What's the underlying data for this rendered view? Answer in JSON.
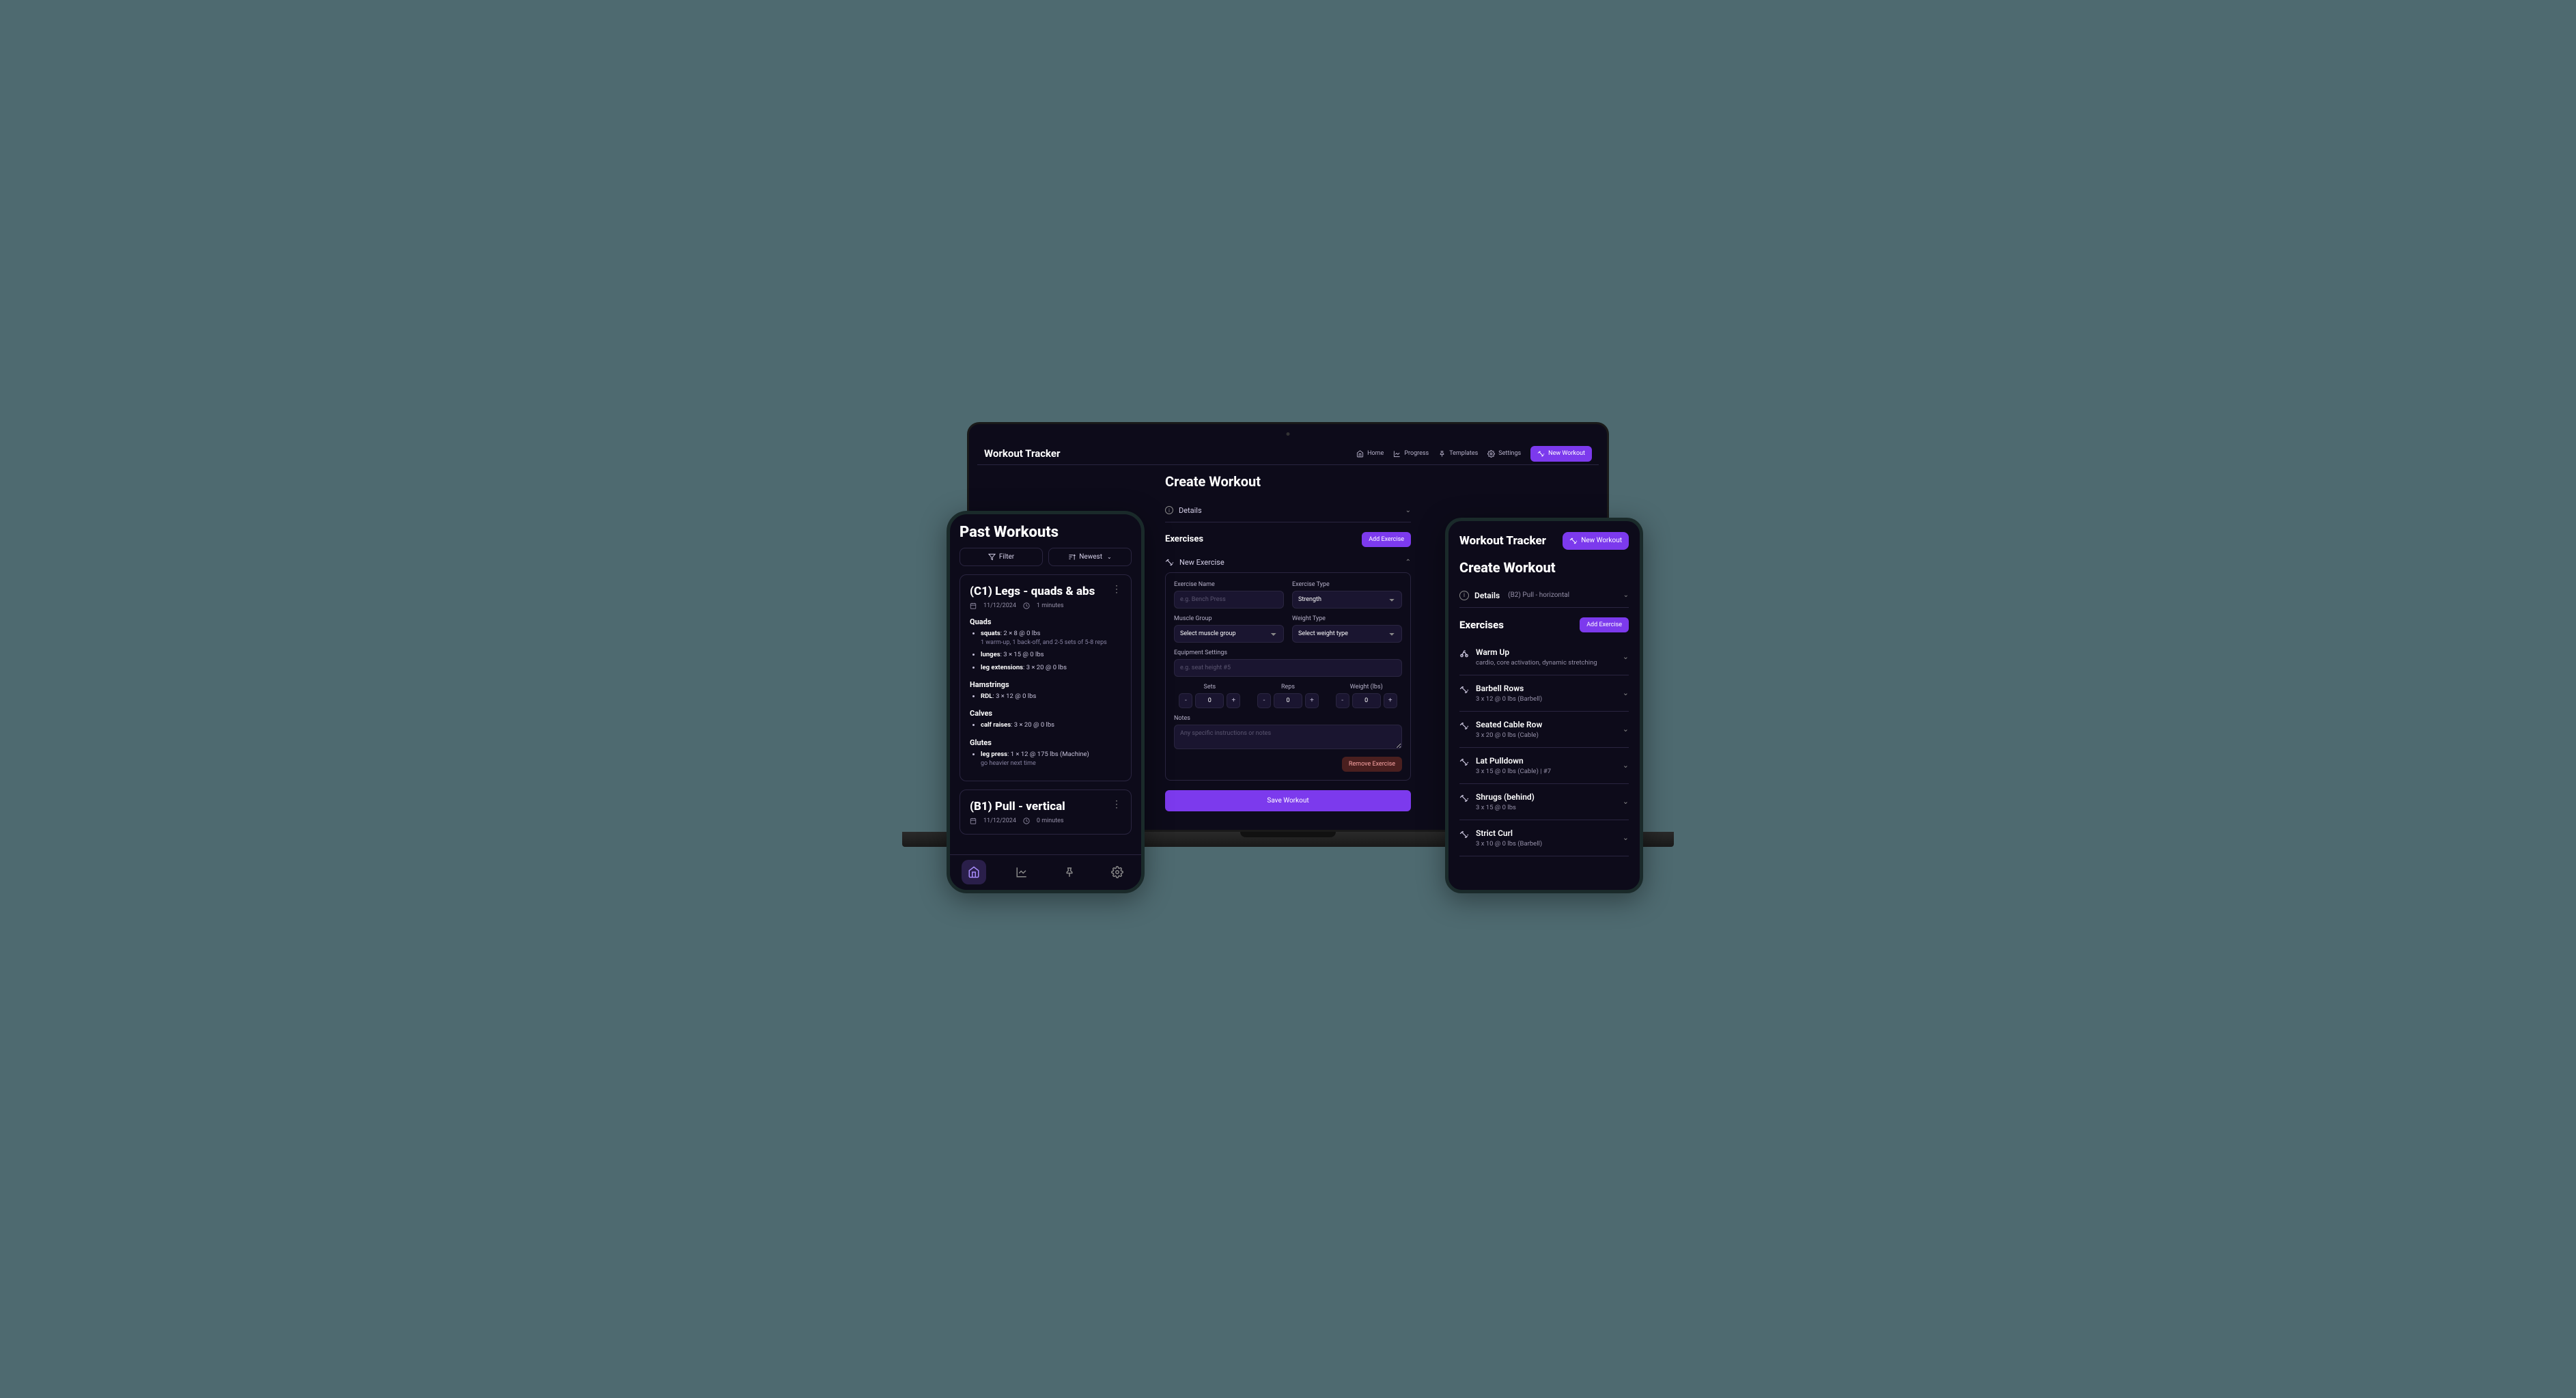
{
  "laptop": {
    "brand": "Workout Tracker",
    "nav": {
      "home": "Home",
      "progress": "Progress",
      "templates": "Templates",
      "settings": "Settings",
      "new_workout": "New Workout"
    },
    "page_title": "Create Workout",
    "details_label": "Details",
    "exercises_label": "Exercises",
    "add_exercise": "Add Exercise",
    "new_exercise_label": "New Exercise",
    "form": {
      "name_label": "Exercise Name",
      "name_placeholder": "e.g. Bench Press",
      "type_label": "Exercise Type",
      "type_value": "Strength",
      "muscle_label": "Muscle Group",
      "muscle_value": "Select muscle group",
      "weight_type_label": "Weight Type",
      "weight_type_value": "Select weight type",
      "equip_label": "Equipment Settings",
      "equip_placeholder": "e.g. seat height #5",
      "sets_label": "Sets",
      "sets_value": "0",
      "reps_label": "Reps",
      "reps_value": "0",
      "weight_label": "Weight (lbs)",
      "weight_value": "0",
      "notes_label": "Notes",
      "notes_placeholder": "Any specific instructions or notes",
      "remove": "Remove Exercise",
      "save": "Save Workout"
    }
  },
  "phone": {
    "title": "Past Workouts",
    "filter": "Filter",
    "sort": "Newest",
    "workouts": [
      {
        "title": "(C1) Legs - quads & abs",
        "date": "11/12/2024",
        "duration": "1 minutes",
        "groups": [
          {
            "name": "Quads",
            "items": [
              {
                "name": "squats",
                "detail": ": 2 × 8 @ 0 lbs",
                "note": "1 warm-up, 1 back-off, and 2-5 sets of 5-8 reps"
              },
              {
                "name": "lunges",
                "detail": ": 3 × 15 @ 0 lbs"
              },
              {
                "name": "leg extensions",
                "detail": ": 3 × 20 @ 0 lbs"
              }
            ]
          },
          {
            "name": "Hamstrings",
            "items": [
              {
                "name": "RDL",
                "detail": ": 3 × 12 @ 0 lbs"
              }
            ]
          },
          {
            "name": "Calves",
            "items": [
              {
                "name": "calf raises",
                "detail": ": 3 × 20 @ 0 lbs"
              }
            ]
          },
          {
            "name": "Glutes",
            "items": [
              {
                "name": "leg press",
                "detail": ": 1 × 12 @ 175 lbs (Machine)",
                "note": "go heavier next time"
              }
            ]
          }
        ]
      },
      {
        "title": "(B1) Pull - vertical",
        "date": "11/12/2024",
        "duration": "0 minutes"
      }
    ]
  },
  "tablet": {
    "brand": "Workout Tracker",
    "new_workout": "New Workout",
    "page_title": "Create Workout",
    "details_label": "Details",
    "details_sub": "(B2) Pull - horizontal",
    "exercises_label": "Exercises",
    "add_exercise": "Add Exercise",
    "exercises": [
      {
        "icon": "bike",
        "name": "Warm Up",
        "detail": "cardio, core activation, dynamic stretching"
      },
      {
        "icon": "dumbbell",
        "name": "Barbell Rows",
        "detail": "3 x 12 @ 0 lbs (Barbell)"
      },
      {
        "icon": "dumbbell",
        "name": "Seated Cable Row",
        "detail": "3 x 20 @ 0 lbs (Cable)"
      },
      {
        "icon": "dumbbell",
        "name": "Lat Pulldown",
        "detail": "3 x 15 @ 0 lbs (Cable) | #7"
      },
      {
        "icon": "dumbbell",
        "name": "Shrugs (behind)",
        "detail": "3 x 15 @ 0 lbs"
      },
      {
        "icon": "dumbbell",
        "name": "Strict Curl",
        "detail": "3 x 10 @ 0 lbs (Barbell)"
      }
    ]
  }
}
